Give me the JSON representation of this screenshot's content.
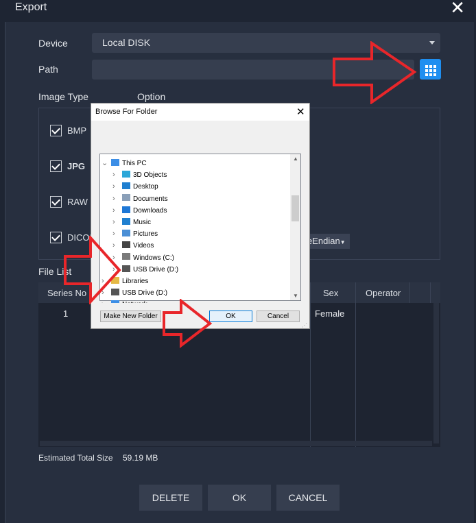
{
  "window": {
    "title": "Export",
    "close_glyph": "✕"
  },
  "form": {
    "device_label": "Device",
    "device_value": "Local DISK",
    "path_label": "Path",
    "path_value": "",
    "image_type_label": "Image Type",
    "option_label": "Option"
  },
  "image_types": [
    {
      "label": "BMP",
      "checked": true
    },
    {
      "label": "JPG",
      "checked": true
    },
    {
      "label": "RAW",
      "checked": true
    },
    {
      "label": "DICOM",
      "checked": true
    }
  ],
  "dicom_option_value": "eEndian",
  "file_list": {
    "label": "File List",
    "columns": [
      "Series No",
      "Sex",
      "Operator"
    ],
    "rows": [
      {
        "series_no": "1",
        "sex": "Female",
        "operator": ""
      }
    ]
  },
  "estimated": {
    "label": "Estimated Total Size",
    "value": "59.19 MB"
  },
  "footer": {
    "delete": "DELETE",
    "ok": "OK",
    "cancel": "CANCEL"
  },
  "dialog": {
    "title": "Browse For Folder",
    "tree": [
      {
        "label": "This PC",
        "icon": "computer-icon",
        "expander": "expanded"
      },
      {
        "label": "3D Objects",
        "icon": "cube-icon",
        "expander": "collapsed"
      },
      {
        "label": "Desktop",
        "icon": "desktop-icon",
        "expander": "collapsed"
      },
      {
        "label": "Documents",
        "icon": "document-icon",
        "expander": "collapsed"
      },
      {
        "label": "Downloads",
        "icon": "download-icon",
        "expander": "collapsed"
      },
      {
        "label": "Music",
        "icon": "music-icon",
        "expander": "collapsed"
      },
      {
        "label": "Pictures",
        "icon": "pictures-icon",
        "expander": "collapsed"
      },
      {
        "label": "Videos",
        "icon": "video-icon",
        "expander": "collapsed"
      },
      {
        "label": "Windows (C:)",
        "icon": "drive-icon",
        "expander": "collapsed"
      },
      {
        "label": "USB Drive (D:)",
        "icon": "usb-drive-icon",
        "expander": "collapsed"
      },
      {
        "label": "Libraries",
        "icon": "folder-icon",
        "expander": "collapsed"
      },
      {
        "label": "USB Drive (D:)",
        "icon": "usb-drive-icon",
        "expander": "collapsed"
      },
      {
        "label": "Network",
        "icon": "network-icon",
        "expander": "collapsed"
      }
    ],
    "make_new_folder": "Make New Folder",
    "ok": "OK",
    "cancel": "Cancel"
  },
  "colors": {
    "accent": "#1f8ff0",
    "background": "#272f3f",
    "annotation": "#e8262a"
  }
}
